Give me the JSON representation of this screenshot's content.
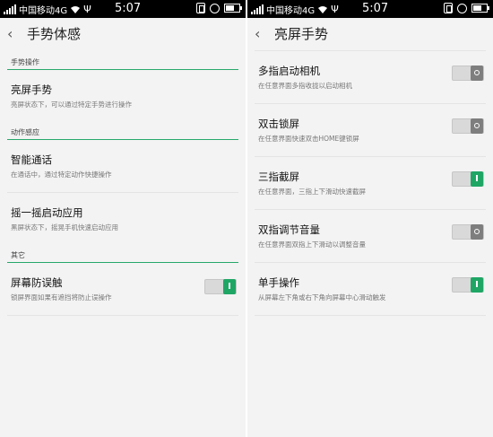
{
  "status_bar": {
    "carrier": "中国移动4G",
    "time": "5:07"
  },
  "left_screen": {
    "title": "手势体感",
    "sections": [
      {
        "label": "手势操作",
        "items": [
          {
            "title": "亮屏手势",
            "subtitle": "亮屏状态下，可以通过特定手势进行操作"
          }
        ]
      },
      {
        "label": "动作感应",
        "items": [
          {
            "title": "智能通话",
            "subtitle": "在通话中，通过特定动作快捷操作"
          },
          {
            "title": "摇一摇启动应用",
            "subtitle": "黑屏状态下，摇晃手机快速启动应用"
          }
        ]
      },
      {
        "label": "其它",
        "items": [
          {
            "title": "屏幕防误触",
            "subtitle": "锁屏界面如果有遮挡将防止误操作",
            "toggle": "on"
          }
        ]
      }
    ]
  },
  "right_screen": {
    "title": "亮屏手势",
    "items": [
      {
        "title": "多指启动相机",
        "subtitle": "在任意界面多指收拢以启动相机",
        "toggle": "off"
      },
      {
        "title": "双击锁屏",
        "subtitle": "在任意界面快速双击HOME键锁屏",
        "toggle": "off"
      },
      {
        "title": "三指截屏",
        "subtitle": "在任意界面，三指上下滑动快速截屏",
        "toggle": "on"
      },
      {
        "title": "双指调节音量",
        "subtitle": "在任意界面双指上下滑动以调整音量",
        "toggle": "off"
      },
      {
        "title": "单手操作",
        "subtitle": "从屏幕左下角或右下角向屏幕中心滑动触发",
        "toggle": "on"
      }
    ]
  },
  "colors": {
    "accent": "#1fa665",
    "section_line": "#27a86a",
    "background": "#f3f3f3"
  }
}
